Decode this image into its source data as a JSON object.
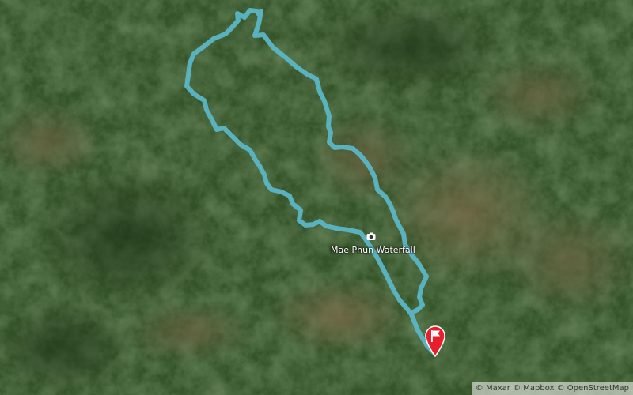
{
  "map": {
    "type": "satellite",
    "route_color": "#5bb6c6",
    "finish_pin_color": "#e5202c",
    "terrain_colors": [
      "#2f4a26",
      "#3b5a2d",
      "#5e6a3a",
      "#7a6a48"
    ]
  },
  "poi": {
    "label": "Mae Phun Waterfall",
    "icon": "camera-icon"
  },
  "finish_marker": {
    "icon": "flag-icon"
  },
  "attribution": {
    "maxar": "© Maxar",
    "mapbox": "© Mapbox",
    "osm": "© OpenStreetMap"
  }
}
